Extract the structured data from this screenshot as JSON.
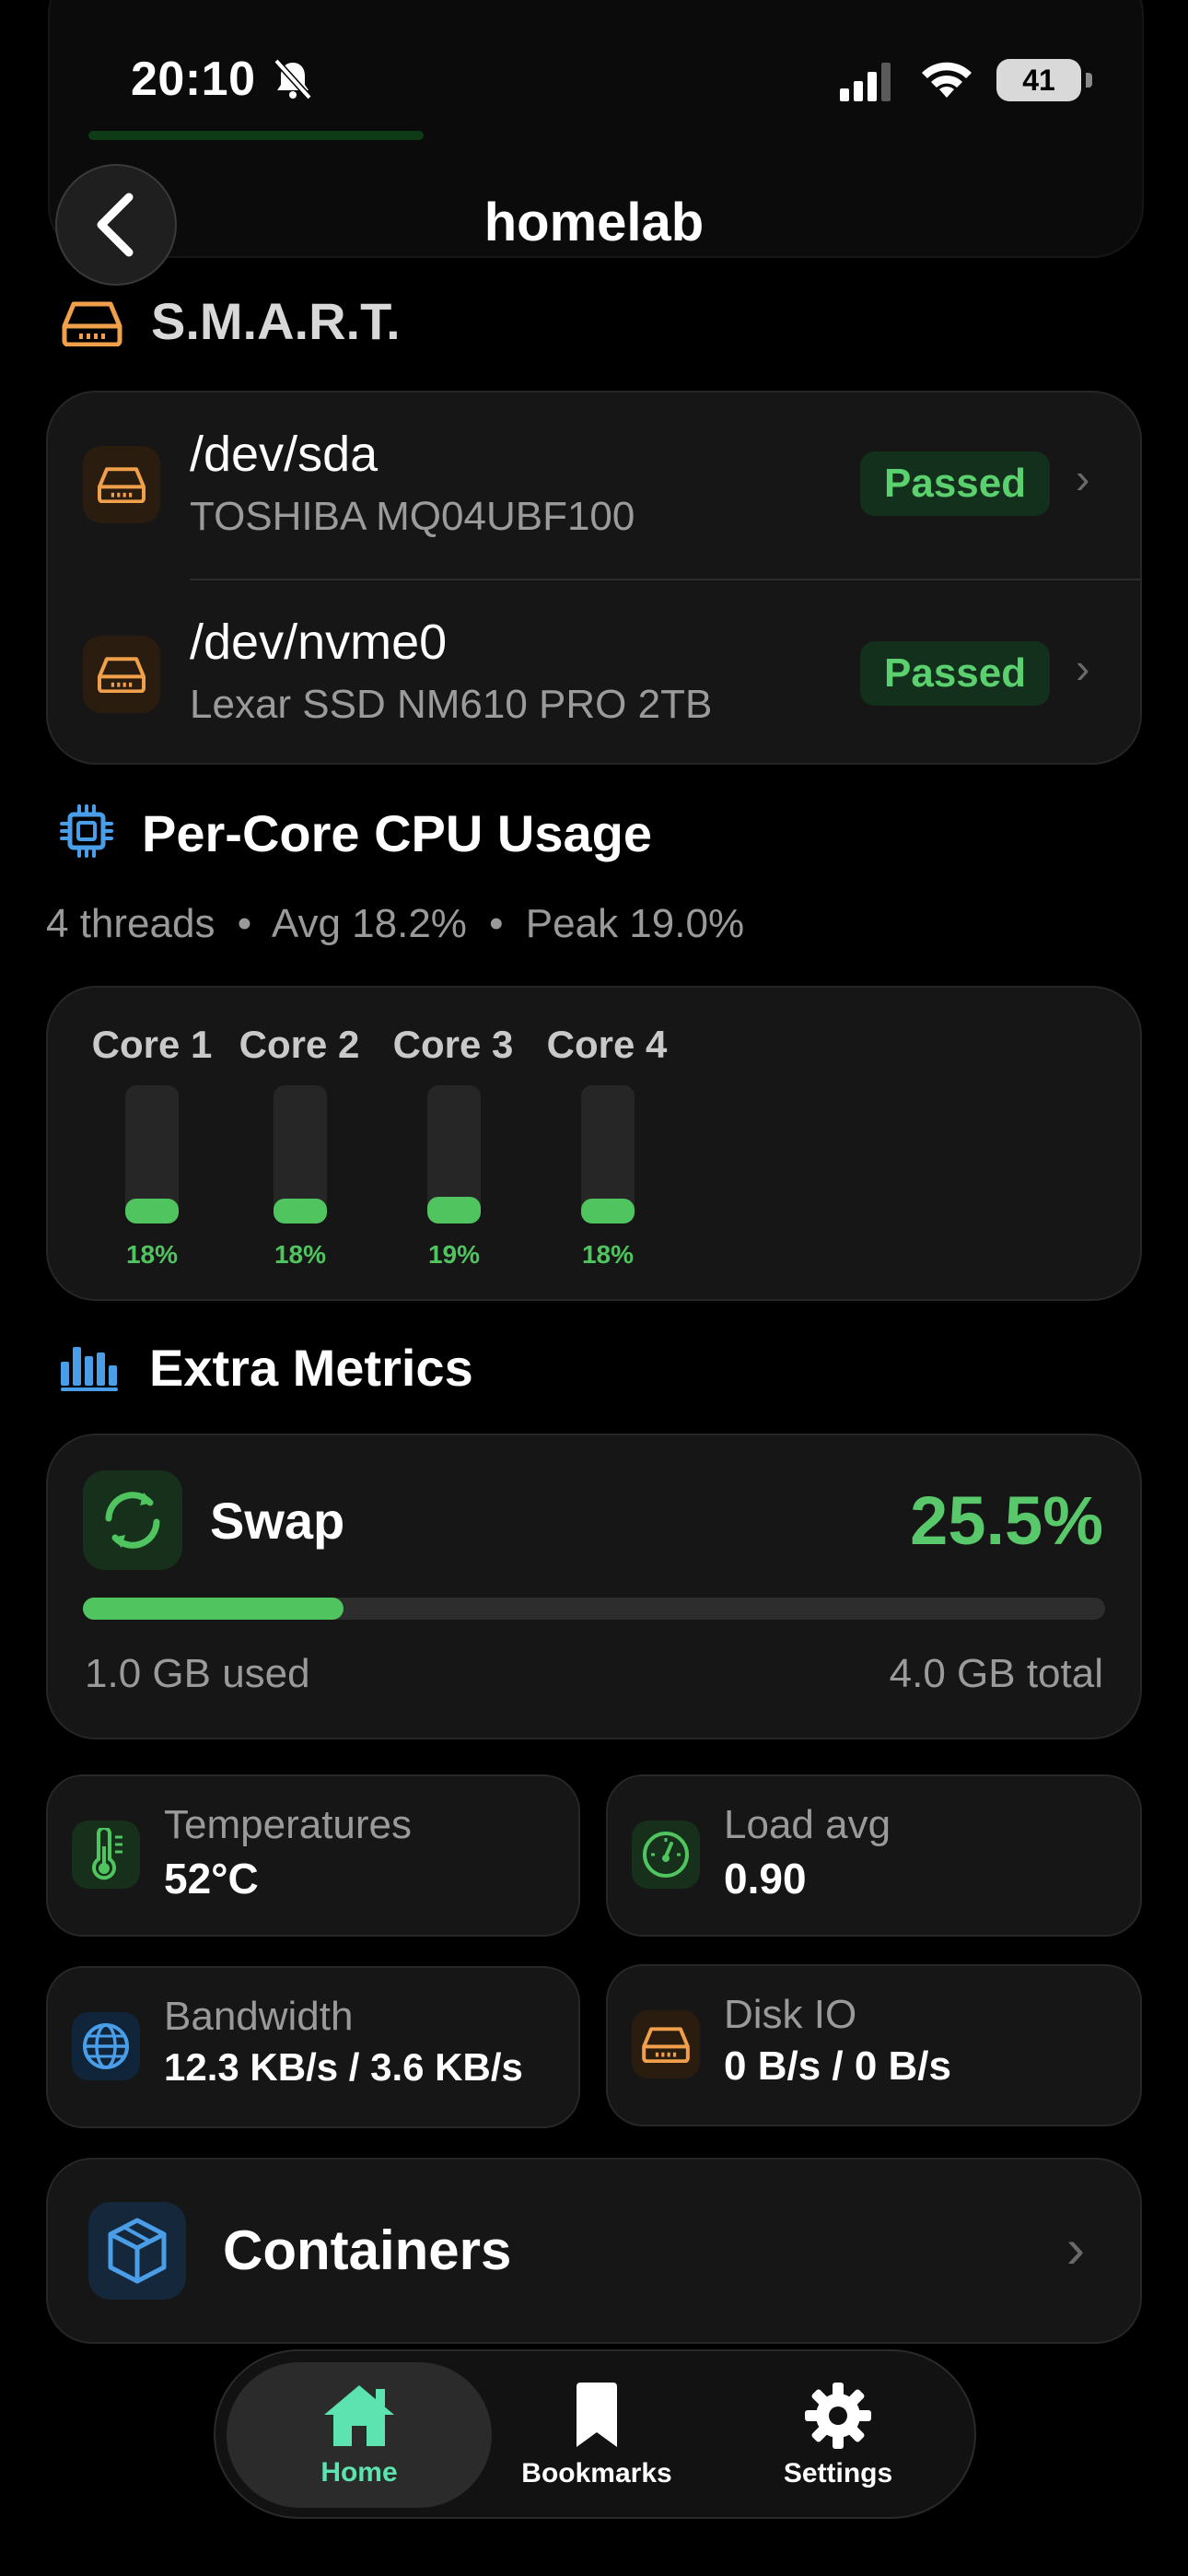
{
  "status_bar": {
    "time": "20:10",
    "battery": "41"
  },
  "nav": {
    "title": "homelab"
  },
  "smart": {
    "title": "S.M.A.R.T.",
    "drives": [
      {
        "device": "/dev/sda",
        "model": "TOSHIBA MQ04UBF100",
        "status": "Passed"
      },
      {
        "device": "/dev/nvme0",
        "model": "Lexar SSD NM610 PRO 2TB",
        "status": "Passed"
      }
    ]
  },
  "cpu": {
    "title": "Per-Core CPU Usage",
    "summary": {
      "threads": "4 threads",
      "avg": "Avg 18.2%",
      "peak": "Peak 19.0%"
    },
    "cores": [
      {
        "label": "Core 1",
        "percent_label": "18%",
        "usage": 18
      },
      {
        "label": "Core 2",
        "percent_label": "18%",
        "usage": 18
      },
      {
        "label": "Core 3",
        "percent_label": "19%",
        "usage": 19
      },
      {
        "label": "Core 4",
        "percent_label": "18%",
        "usage": 18
      }
    ]
  },
  "extra": {
    "title": "Extra Metrics",
    "swap": {
      "label": "Swap",
      "percent_label": "25.5%",
      "percent": 25.5,
      "used": "1.0 GB used",
      "total": "4.0 GB total"
    },
    "tiles": [
      {
        "label": "Temperatures",
        "value": "52°C",
        "icon": "thermometer-icon"
      },
      {
        "label": "Load avg",
        "value": "0.90",
        "icon": "gauge-icon"
      },
      {
        "label": "Bandwidth",
        "value": "12.3 KB/s / 3.6 KB/s",
        "icon": "globe-icon"
      },
      {
        "label": "Disk IO",
        "value": "0 B/s / 0 B/s",
        "icon": "drive-icon"
      }
    ],
    "containers": {
      "label": "Containers"
    }
  },
  "tabs": [
    {
      "label": "Home",
      "active": true,
      "icon": "home-icon"
    },
    {
      "label": "Bookmarks",
      "active": false,
      "icon": "bookmark-icon"
    },
    {
      "label": "Settings",
      "active": false,
      "icon": "gear-icon"
    }
  ],
  "colors": {
    "accent_green": "#4fc45f",
    "drive_orange": "#f0a04b",
    "cpu_blue": "#4a9ee8",
    "tab_active": "#5de3b0"
  }
}
